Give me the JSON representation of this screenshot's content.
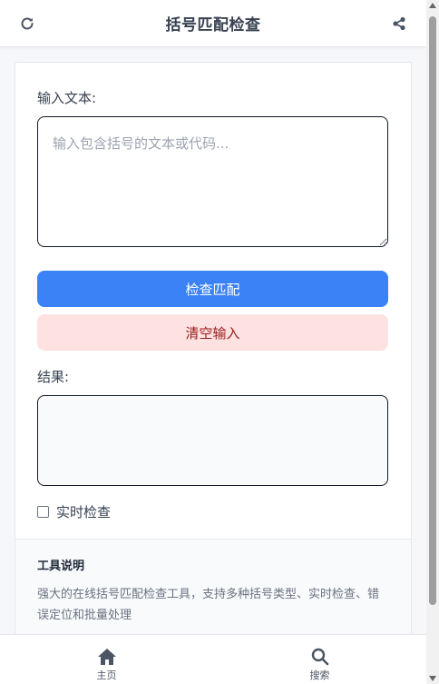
{
  "header": {
    "title": "括号匹配检查",
    "left_icon": "refresh-icon",
    "right_icon": "share-icon"
  },
  "form": {
    "input_label": "输入文本:",
    "input_placeholder": "输入包含括号的文本或代码...",
    "input_value": "",
    "check_button_label": "检查匹配",
    "clear_button_label": "清空输入",
    "result_label": "结果:",
    "result_value": "",
    "realtime_label": "实时检查",
    "realtime_checked": false
  },
  "info": {
    "title": "工具说明",
    "description": "强大的在线括号匹配检查工具，支持多种括号类型、实时检查、错误定位和批量处理"
  },
  "nav": {
    "items": [
      {
        "label": "主页",
        "icon": "home-icon"
      },
      {
        "label": "搜索",
        "icon": "search-icon"
      }
    ]
  },
  "colors": {
    "primary": "#3b82f6",
    "danger_bg": "#fee2e2",
    "danger_text": "#991b1b",
    "icon_color": "#4b5563"
  }
}
